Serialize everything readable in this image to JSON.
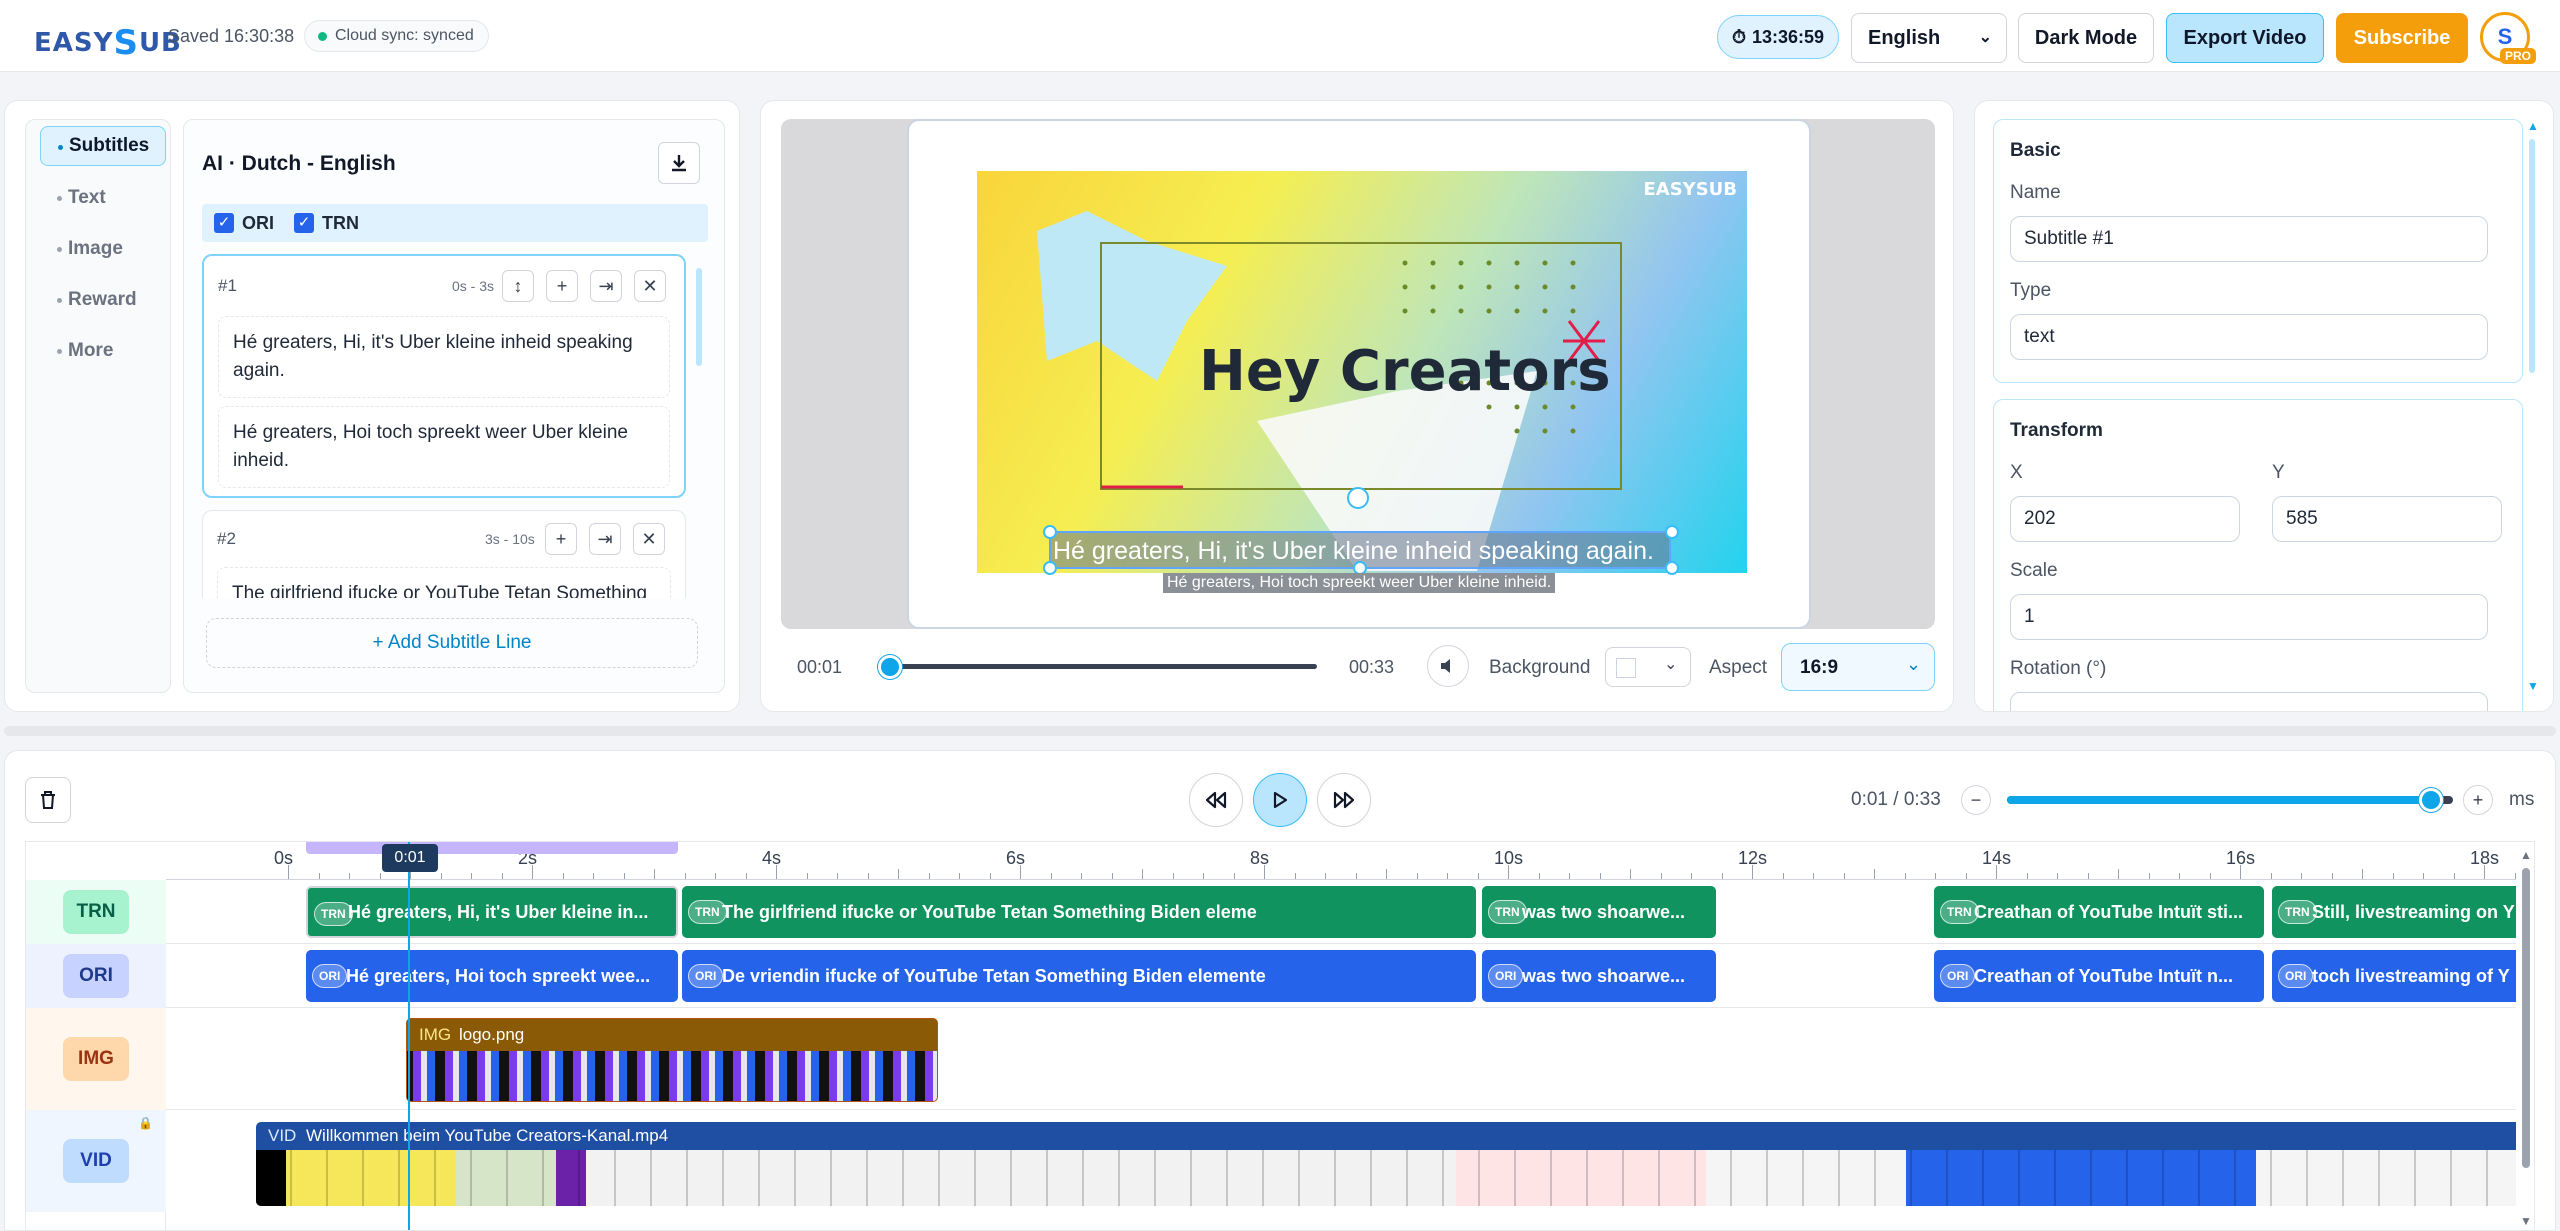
{
  "app": {
    "logo_text": "EASYSUB",
    "saved": "Saved 16:30:38",
    "sync": "Cloud sync: synced"
  },
  "topbar": {
    "timer": "13:36:59",
    "language": "English",
    "dark_mode": "Dark Mode",
    "export": "Export Video",
    "subscribe": "Subscribe",
    "avatar_initial": "S",
    "avatar_badge": "PRO"
  },
  "colors": {
    "accent": "#0ea5e9",
    "subscribe": "#f59e0b",
    "trn": "#10935f",
    "ori": "#2563eb",
    "img": "#8a5a06",
    "vid": "#1e4fa3"
  },
  "sidebar": {
    "items": [
      {
        "label": "Subtitles",
        "active": true
      },
      {
        "label": "Text"
      },
      {
        "label": "Image"
      },
      {
        "label": "Reward"
      },
      {
        "label": "More"
      }
    ]
  },
  "subtitles": {
    "title": "AI · Dutch - English",
    "toggles": [
      {
        "label": "ORI",
        "checked": true
      },
      {
        "label": "TRN",
        "checked": true
      }
    ],
    "lines": [
      {
        "index": "#1",
        "time": "0s - 3s",
        "ori": "Hé greaters, Hi, it's Uber kleine inheid speaking again.",
        "trn": "Hé greaters, Hoi toch spreekt weer Uber kleine inheid."
      },
      {
        "index": "#2",
        "time": "3s - 10s",
        "ori": "The girlfriend ifucke or YouTube Tetan Something"
      }
    ],
    "add_line": "+ Add Subtitle Line"
  },
  "preview": {
    "watermark": "EASYSUB",
    "headline": "Hey Creators",
    "caption_main": "Hé greaters, Hi, it's Uber kleine inheid speaking again.",
    "caption_sub": "Hé greaters, Hoi toch spreekt weer Uber kleine inheid.",
    "current_time": "00:01",
    "duration": "00:33",
    "progress": 0.03,
    "background_label": "Background",
    "aspect_label": "Aspect",
    "aspect_value": "16:9"
  },
  "properties": {
    "basic_title": "Basic",
    "name_label": "Name",
    "name_value": "Subtitle #1",
    "type_label": "Type",
    "type_value": "text",
    "transform_title": "Transform",
    "x_label": "X",
    "x_value": "202",
    "y_label": "Y",
    "y_value": "585",
    "scale_label": "Scale",
    "scale_value": "1",
    "rotation_label": "Rotation (°)"
  },
  "timeline": {
    "time_readout": "0:01 / 0:33",
    "zoom_unit": "ms",
    "zoom_level": 0.95,
    "playhead_label": "0:01",
    "ticks": [
      "0s",
      "2s",
      "4s",
      "6s",
      "8s",
      "10s",
      "12s",
      "14s",
      "16s",
      "18s"
    ],
    "tracks": [
      {
        "name": "TRN",
        "clips": [
          {
            "tag": "TRN",
            "text": "Hé greaters, Hi, it's Uber kleine in..."
          },
          {
            "tag": "TRN",
            "text": "The girlfriend ifucke or YouTube Tetan Something Biden eleme"
          },
          {
            "tag": "TRN",
            "text": "was two shoarwe..."
          },
          {
            "tag": "TRN",
            "text": "Creathan of YouTube Intuït sti..."
          },
          {
            "tag": "TRN",
            "text": "Still, livestreaming on Y"
          }
        ]
      },
      {
        "name": "ORI",
        "clips": [
          {
            "tag": "ORI",
            "text": "Hé greaters, Hoi toch spreekt wee..."
          },
          {
            "tag": "ORI",
            "text": "De vriendin ifucke of YouTube Tetan Something Biden elemente"
          },
          {
            "tag": "ORI",
            "text": "was two shoarwe..."
          },
          {
            "tag": "ORI",
            "text": "Creathan of YouTube Intuït n..."
          },
          {
            "tag": "ORI",
            "text": "toch livestreaming of Y"
          }
        ]
      },
      {
        "name": "IMG",
        "clips": [
          {
            "tag": "IMG",
            "text": "logo.png"
          }
        ]
      },
      {
        "name": "VID",
        "clips": [
          {
            "tag": "VID",
            "text": "Willkommen beim YouTube Creators-Kanal.mp4"
          }
        ]
      }
    ]
  }
}
